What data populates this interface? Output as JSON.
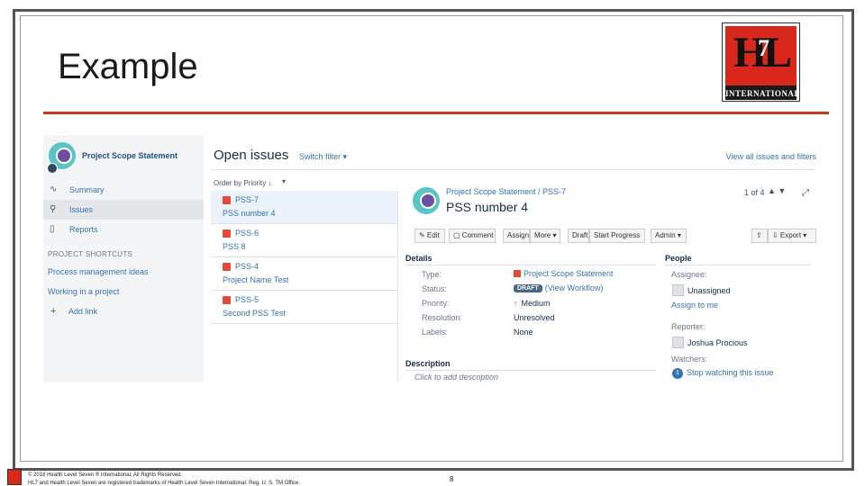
{
  "slide": {
    "title": "Example",
    "logo_text": "INTERNATIONAL",
    "logo_letters": "HL",
    "logo_seven": "7",
    "footer_line1": "© 2018 Health Level Seven ® International. All Rights Reserved.",
    "footer_line2": "HL7 and Health Level Seven are registered trademarks of Health Level Seven International. Reg. U. S. TM Office.",
    "page_number": "8",
    "colors": {
      "rule": "#c0391b",
      "logo_red": "#d8281b"
    }
  },
  "sidebar": {
    "project_name": "Project Scope Statement",
    "items": [
      {
        "icon": "pulse-icon",
        "glyph": "∿",
        "label": "Summary"
      },
      {
        "icon": "search-icon",
        "glyph": "⚲",
        "label": "Issues",
        "active": true
      },
      {
        "icon": "reports-icon",
        "glyph": "▯",
        "label": "Reports"
      }
    ],
    "shortcuts_heading": "PROJECT SHORTCUTS",
    "shortcuts": [
      "Process management ideas",
      "Working in a project"
    ],
    "add_link": "Add link"
  },
  "list": {
    "title": "Open issues",
    "switch_filter": "Switch filter ▾",
    "view_all": "View all issues and filters",
    "order_by": "Order by Priority ↓",
    "order_menu": "▾",
    "issues": [
      {
        "key": "PSS-7",
        "summary": "PSS number 4"
      },
      {
        "key": "PSS-6",
        "summary": "PSS 8"
      },
      {
        "key": "PSS-4",
        "summary": "Project Name Test"
      },
      {
        "key": "PSS-5",
        "summary": "Second PSS Test"
      }
    ]
  },
  "detail": {
    "breadcrumb": "Project Scope Statement  /  PSS-7",
    "title": "PSS number 4",
    "pager": "1 of 4",
    "pager_arrows": "▲ ▼",
    "expand": "⤢",
    "toolbar": [
      "✎ Edit",
      "▢ Comment",
      "Assign",
      "More ▾",
      "Draft",
      "Start Progress",
      "Admin ▾",
      "⇪",
      "⇩ Export ▾"
    ],
    "details_heading": "Details",
    "fields": [
      {
        "label": "Type:",
        "value": "Project Scope Statement"
      },
      {
        "label": "Status:",
        "value": "(View Workflow)",
        "lozenge": "DRAFT"
      },
      {
        "label": "Priority:",
        "value": "Medium",
        "arrow": "↑"
      },
      {
        "label": "Resolution:",
        "value": "Unresolved"
      },
      {
        "label": "Labels:",
        "value": "None"
      }
    ],
    "people_heading": "People",
    "assignee_label": "Assignee:",
    "assignee_value": "Unassigned",
    "assign_to_me": "Assign to me",
    "reporter_label": "Reporter:",
    "reporter_value": "Joshua Procious",
    "watchers_label": "Watchers:",
    "watchers_count": "1",
    "watch_link": "Stop watching this issue",
    "description_heading": "Description",
    "description_placeholder": "Click to add description"
  }
}
